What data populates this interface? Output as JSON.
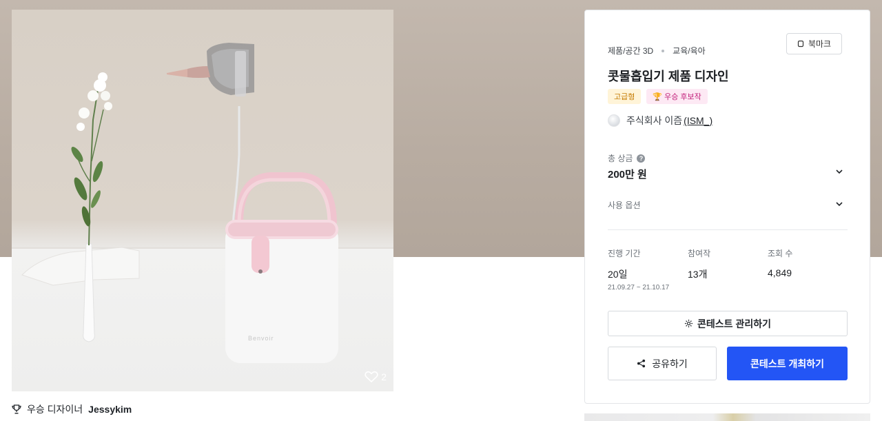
{
  "hero": {
    "alt": "콧물흡입기 제품 디자인",
    "product_brand_text": "Benvoir",
    "like_count": "2"
  },
  "winner": {
    "prefix": "우승 디자이너",
    "name": "Jessykim"
  },
  "card": {
    "categories": [
      "제품/공간 3D",
      "교육/육아"
    ],
    "bookmark_label": "북마크",
    "title": "콧물흡입기 제품 디자인",
    "badges": {
      "tier": "고급형",
      "award": "우승 후보작"
    },
    "company": {
      "name": "주식회사 이즘",
      "handle": "(ISM_)"
    },
    "prize": {
      "label": "총 상금",
      "value": "200만 원"
    },
    "options_label": "사용 옵션",
    "stats": {
      "period_label": "진행 기간",
      "period_value": "20일",
      "period_range": "21.09.27 ~ 21.10.17",
      "entries_label": "참여작",
      "entries_value": "13개",
      "views_label": "조회 수",
      "views_value": "4,849"
    },
    "manage_button": "콘테스트 관리하기",
    "share_button": "공유하기",
    "host_button": "콘테스트 개최하기"
  },
  "colors": {
    "primary_button": "#2355f5",
    "backdrop": "#b8aca1",
    "tier_badge_text": "#c47a00",
    "award_badge_text": "#c21e7a"
  },
  "icons": [
    "heart-icon",
    "trophy-icon",
    "bookmark-icon",
    "help-icon",
    "chevron-down-icon",
    "gear-icon",
    "share-icon"
  ]
}
